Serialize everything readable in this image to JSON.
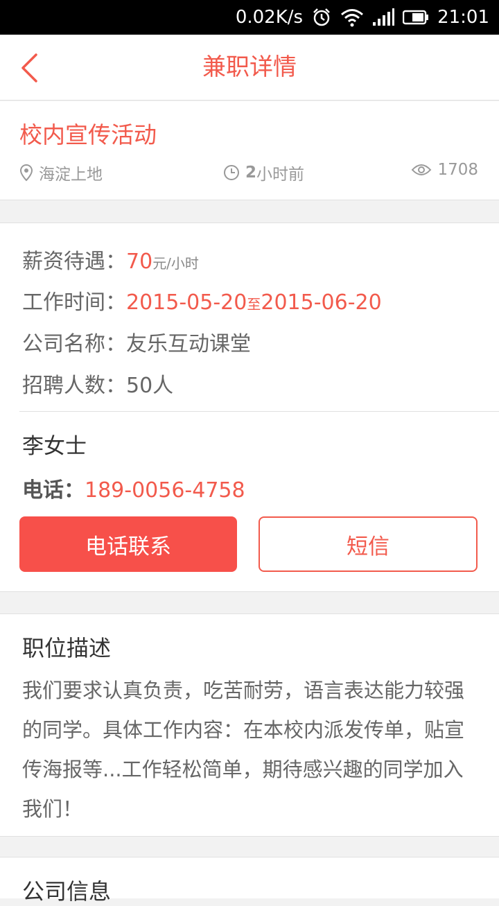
{
  "status_bar": {
    "net_speed": "0.02K/s",
    "time": "21:01",
    "icons": [
      "alarm-icon",
      "wifi-icon",
      "signal-icon",
      "battery-icon"
    ]
  },
  "header": {
    "title": "兼职详情",
    "back_icon": "chevron-left-icon"
  },
  "job": {
    "title": "校内宣传活动",
    "location": "海淀上地",
    "time_ago_num": "2",
    "time_ago_unit": "小时前",
    "views": "1708"
  },
  "details": {
    "salary_label": "薪资待遇：",
    "salary_value": "70",
    "salary_unit": "元/小时",
    "work_time_label": "工作时间：",
    "work_start": "2015-05-20",
    "work_to": "至",
    "work_end": "2015-06-20",
    "company_label": "公司名称：",
    "company_value": "友乐互动课堂",
    "headcount_label": "招聘人数：",
    "headcount_value": "50人"
  },
  "contact": {
    "name": "李女士",
    "phone_label": "电话：",
    "phone_value": "189-0056-4758",
    "call_button": "电话联系",
    "sms_button": "短信"
  },
  "description": {
    "title": "职位描述",
    "text": "我们要求认真负责，吃苦耐劳，语言表达能力较强的同学。具体工作内容：在本校内派发传单，贴宣传海报等...工作轻松简单，期待感兴趣的同学加入我们！"
  },
  "company_info": {
    "title": "公司信息"
  },
  "colors": {
    "accent": "#f25a4c",
    "button_fill": "#f7504a",
    "text_gray": "#666666"
  }
}
